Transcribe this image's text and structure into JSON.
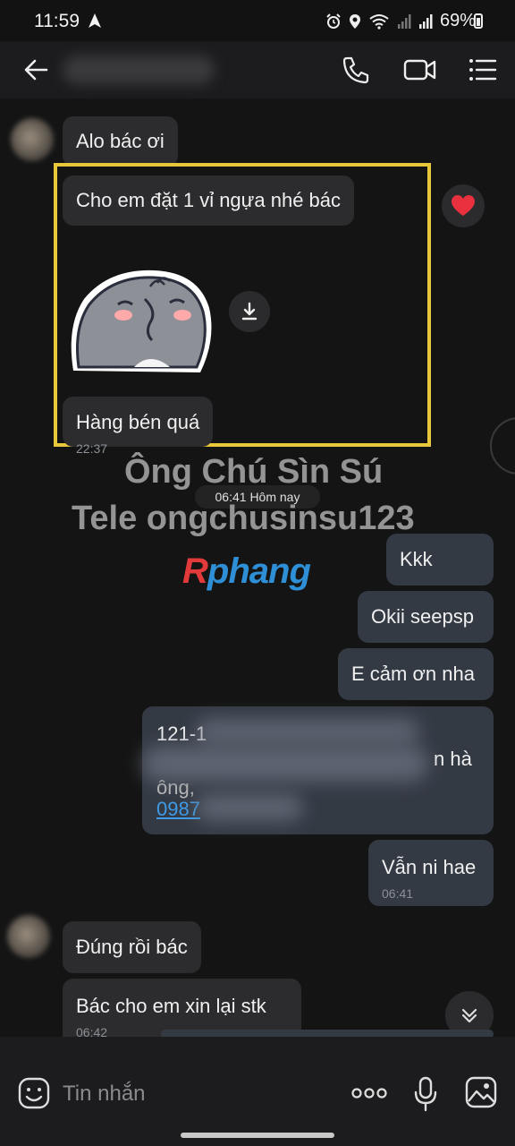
{
  "status_bar": {
    "time": "11:59",
    "battery": "69%"
  },
  "header": {
    "icons": [
      "back-arrow-icon",
      "phone-icon",
      "video-call-icon",
      "menu-icon"
    ]
  },
  "messages": [
    {
      "text": "Alo bác ơi",
      "side": "incoming"
    },
    {
      "text": "Cho em đặt 1 vỉ ngựa nhé bác",
      "side": "incoming",
      "reaction": "heart"
    },
    {
      "text": "Hàng bén quá",
      "side": "incoming",
      "time": "22:37"
    },
    {
      "text": "Kkk",
      "side": "outgoing"
    },
    {
      "text": "Okii seepsp",
      "side": "outgoing"
    },
    {
      "text": "E cảm ơn nha",
      "side": "outgoing"
    },
    {
      "line1": "121-1",
      "line2": "n hà",
      "line3": "ông,",
      "link": "0987",
      "side": "outgoing"
    },
    {
      "text": "Vẫn ni hae",
      "side": "outgoing",
      "time": "06:41"
    },
    {
      "text": "Đúng rồi bác",
      "side": "incoming"
    },
    {
      "text": "Bác cho em xin lại stk",
      "side": "incoming",
      "time": "06:42"
    }
  ],
  "date_divider": "06:41 Hôm nay",
  "watermark": {
    "line1": "Ông Chú Sìn Sú",
    "line2": "Tele ongchusinsu123",
    "logo_r": "R",
    "logo_rest": "phang"
  },
  "input": {
    "placeholder": "Tin nhắn"
  },
  "colors": {
    "highlight": "#e8c83a",
    "link": "#3d9be9",
    "logo_red": "#e23a3a",
    "logo_blue": "#2f8fd6"
  }
}
